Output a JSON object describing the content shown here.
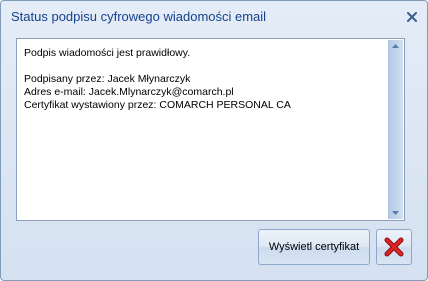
{
  "window": {
    "title": "Status podpisu cyfrowego wiadomości email"
  },
  "message": {
    "status": "Podpis wiadomości jest prawidłowy.",
    "signed_by": "Podpisany przez: Jacek Młynarczyk",
    "email": "Adres e-mail: Jacek.Mlynarczyk@comarch.pl",
    "issuer": "Certyfikat wystawiony przez: COMARCH PERSONAL CA"
  },
  "buttons": {
    "show_certificate": "Wyświetl certyfikat",
    "close_icon": "red-x-icon"
  },
  "icons": {
    "titlebar_close": "close-icon",
    "scroll_up": "scroll-up-arrow-icon",
    "scroll_down": "scroll-down-arrow-icon"
  },
  "colors": {
    "title_text": "#15428b",
    "window_bg": "#dfe8f6",
    "close_x": "#d21f1f"
  }
}
